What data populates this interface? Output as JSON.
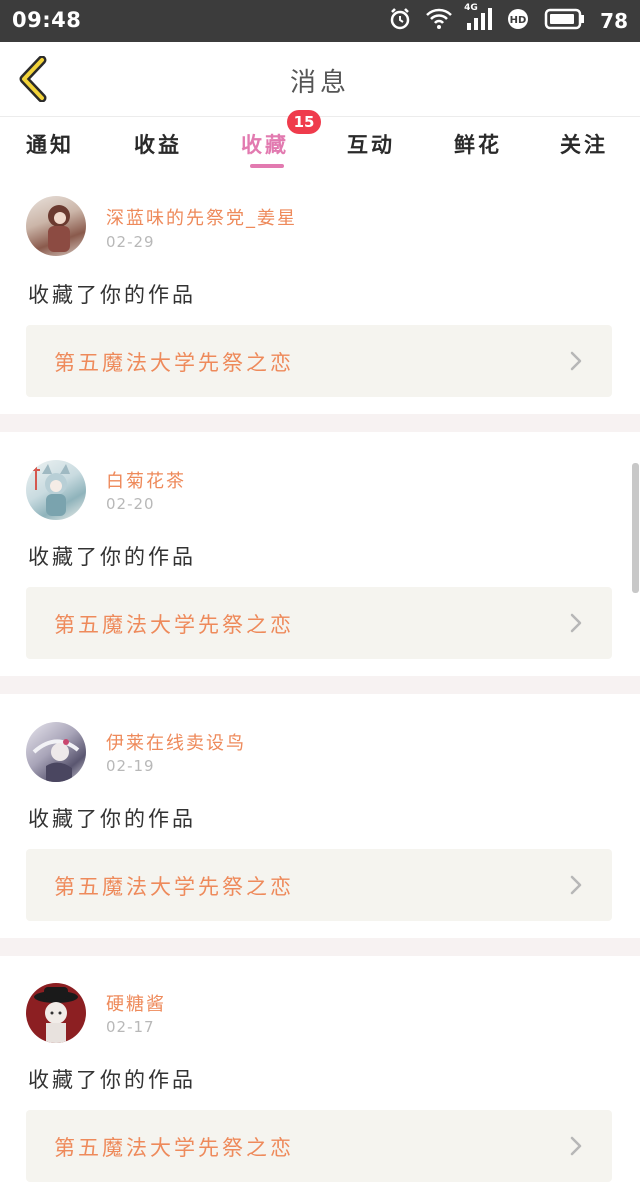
{
  "status_bar": {
    "time": "09:48",
    "network": "4G",
    "battery": "78",
    "icons": [
      "alarm-icon",
      "wifi-icon",
      "signal-icon",
      "hd-icon",
      "battery-icon"
    ]
  },
  "header": {
    "title": "消息",
    "back_icon": "chevron-left-icon"
  },
  "tabs": [
    {
      "label": "通知",
      "active": false
    },
    {
      "label": "收益",
      "active": false
    },
    {
      "label": "收藏",
      "active": true,
      "badge": "15"
    },
    {
      "label": "互动",
      "active": false
    },
    {
      "label": "鲜花",
      "active": false
    },
    {
      "label": "关注",
      "active": false
    }
  ],
  "messages": [
    {
      "user": "深蓝味的先祭党_姜星",
      "date": "02-29",
      "text": "收藏了你的作品",
      "work_title": "第五魔法大学先祭之恋"
    },
    {
      "user": "白菊花茶",
      "date": "02-20",
      "text": "收藏了你的作品",
      "work_title": "第五魔法大学先祭之恋"
    },
    {
      "user": "伊莱在线卖设鸟",
      "date": "02-19",
      "text": "收藏了你的作品",
      "work_title": "第五魔法大学先祭之恋"
    },
    {
      "user": "硬糖酱",
      "date": "02-17",
      "text": "收藏了你的作品",
      "work_title": "第五魔法大学先祭之恋"
    }
  ],
  "colors": {
    "accent": "#e27ab0",
    "username": "#ee8a5b",
    "badge": "#ef3b4c",
    "card_bg": "#f5f4ef",
    "status_bar": "#3c3c3c"
  }
}
